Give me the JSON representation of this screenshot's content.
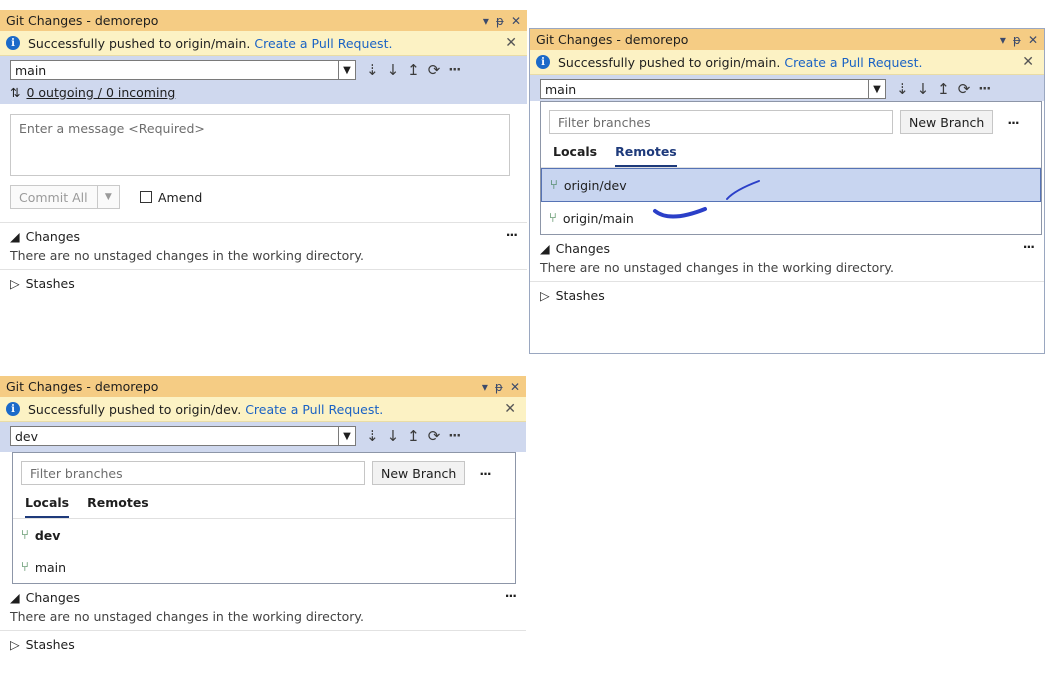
{
  "panel_main": {
    "title": "Git Changes - demorepo",
    "info_text": "Successfully pushed to origin/main.",
    "info_link": "Create a Pull Request.",
    "branch": "main",
    "sync": "0 outgoing / 0 incoming",
    "message_placeholder": "Enter a message <Required>",
    "commit_label": "Commit All",
    "amend_label": "Amend",
    "changes_title": "Changes",
    "changes_desc": "There are no unstaged changes in the working directory.",
    "stashes_title": "Stashes"
  },
  "panel_remotes": {
    "title": "Git Changes - demorepo",
    "info_text": "Successfully pushed to origin/main.",
    "info_link": "Create a Pull Request.",
    "branch": "main",
    "filter_placeholder": "Filter branches",
    "new_branch": "New Branch",
    "tabs": [
      "Locals",
      "Remotes"
    ],
    "items": [
      "origin/dev",
      "origin/main"
    ],
    "changes_title": "Changes",
    "changes_desc": "There are no unstaged changes in the working directory.",
    "stashes_title": "Stashes"
  },
  "panel_locals": {
    "title": "Git Changes - demorepo",
    "info_text": "Successfully pushed to origin/dev.",
    "info_link": "Create a Pull Request.",
    "branch": "dev",
    "filter_placeholder": "Filter branches",
    "new_branch": "New Branch",
    "tabs": [
      "Locals",
      "Remotes"
    ],
    "items": [
      "dev",
      "main"
    ],
    "changes_title": "Changes",
    "changes_desc": "There are no unstaged changes in the working directory.",
    "stashes_title": "Stashes"
  },
  "colors": {
    "title_bar": "#f5cc84",
    "info_bar": "#fcf2c4",
    "branch_bar": "#cfd8ee",
    "link": "#1a62c4",
    "selection": "#c8d5f0",
    "annotation_ink": "#2b3fc8"
  },
  "icons": {
    "info": "info-icon",
    "fetch": "fetch-icon",
    "pull": "pull-icon",
    "push": "push-icon",
    "sync": "sync-icon",
    "more": "more-icon",
    "branch": "branch-icon",
    "remote_branch": "remote-branch-icon"
  }
}
